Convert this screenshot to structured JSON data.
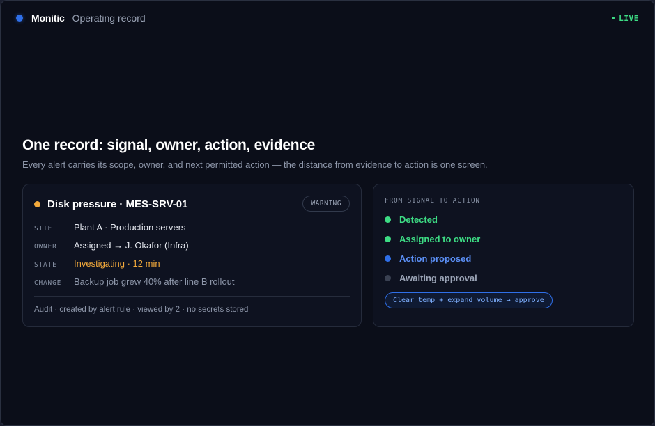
{
  "app": {
    "brand": "Monitic",
    "subtitle": "Operating record",
    "live_label": "LIVE",
    "colors": {
      "accent": "#2f6fe8",
      "live": "#3ddc84",
      "warning": "#f2a93b",
      "background": "#0b0e19"
    }
  },
  "hero": {
    "title": "One record: signal, owner, action, evidence",
    "description": "Every alert carries its scope, owner, and next permitted action — the distance from evidence to action is one screen."
  },
  "alert": {
    "title": "Disk pressure · MES-SRV-01",
    "severity": "WARNING",
    "rows": [
      {
        "key": "SITE",
        "value": "Plant A · Production servers"
      },
      {
        "key": "OWNER",
        "value": "Assigned → J. Okafor (Infra)"
      },
      {
        "key": "STATE",
        "value": "Investigating · 12 min"
      },
      {
        "key": "CHANGE",
        "value": "Backup job grew 40% after line B rollout"
      }
    ],
    "audit": "Audit · created by alert rule · viewed by 2 · no secrets stored"
  },
  "flow": {
    "heading": "FROM SIGNAL TO ACTION",
    "steps": [
      {
        "label": "Detected",
        "status": "done",
        "color": "#3ddc84"
      },
      {
        "label": "Assigned to owner",
        "status": "done",
        "color": "#3ddc84"
      },
      {
        "label": "Action proposed",
        "status": "current",
        "color": "#2f6fe8"
      },
      {
        "label": "Awaiting approval",
        "status": "pending",
        "color": "#3a4152"
      }
    ],
    "action_label": "Clear temp + expand volume → approve"
  }
}
